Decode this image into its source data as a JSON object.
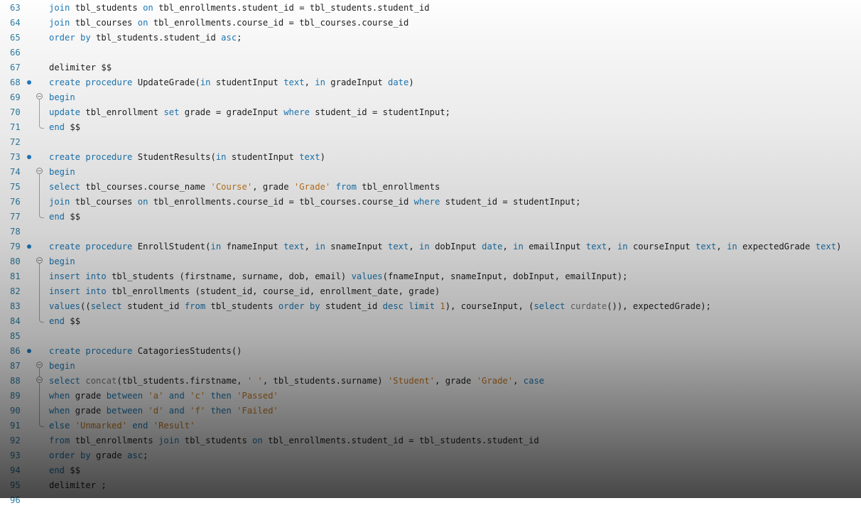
{
  "editor": {
    "language": "sql",
    "colors": {
      "keyword": "#1c7ab8",
      "string": "#c87a20",
      "function": "#7d7d7d",
      "identifier": "#1e1e1e",
      "line_number": "#2f7fa3",
      "breakpoint": "#1e7ec8"
    },
    "lines": [
      {
        "n": "63",
        "bp": false,
        "fold": "",
        "tokens": [
          [
            "kw",
            "join"
          ],
          [
            "",
            "tbl_students "
          ],
          [
            "kw",
            "on"
          ],
          [
            "",
            "tbl_enrollments.student_id = tbl_students.student_id"
          ]
        ]
      },
      {
        "n": "64",
        "bp": false,
        "fold": "",
        "tokens": [
          [
            "kw",
            "join"
          ],
          [
            "",
            "tbl_courses "
          ],
          [
            "kw",
            "on"
          ],
          [
            "",
            "tbl_enrollments.course_id = tbl_courses.course_id"
          ]
        ]
      },
      {
        "n": "65",
        "bp": false,
        "fold": "",
        "tokens": [
          [
            "kw",
            "order by"
          ],
          [
            "",
            "tbl_students.student_id "
          ],
          [
            "kw",
            "asc"
          ],
          [
            "",
            ";"
          ]
        ]
      },
      {
        "n": "66",
        "bp": false,
        "fold": "",
        "tokens": []
      },
      {
        "n": "67",
        "bp": false,
        "fold": "",
        "tokens": [
          [
            "",
            "delimiter $$"
          ]
        ]
      },
      {
        "n": "68",
        "bp": true,
        "fold": "",
        "tokens": [
          [
            "kw",
            "create procedure"
          ],
          [
            "",
            "UpdateGrade("
          ],
          [
            "kw",
            "in"
          ],
          [
            "",
            "studentInput "
          ],
          [
            "kw",
            "text"
          ],
          [
            "",
            ", "
          ],
          [
            "kw",
            "in"
          ],
          [
            "",
            "gradeInput "
          ],
          [
            "kw",
            "date"
          ],
          [
            "",
            ")"
          ]
        ]
      },
      {
        "n": "69",
        "bp": false,
        "fold": "start",
        "tokens": [
          [
            "kw",
            "begin"
          ]
        ]
      },
      {
        "n": "70",
        "bp": false,
        "fold": "mid",
        "tokens": [
          [
            "kw",
            "update"
          ],
          [
            "",
            "tbl_enrollment "
          ],
          [
            "kw",
            "set"
          ],
          [
            "",
            "grade = gradeInput "
          ],
          [
            "kw",
            "where"
          ],
          [
            "",
            "student_id = studentInput;"
          ]
        ]
      },
      {
        "n": "71",
        "bp": false,
        "fold": "end",
        "tokens": [
          [
            "kw",
            "end"
          ],
          [
            "",
            "$$"
          ]
        ]
      },
      {
        "n": "72",
        "bp": false,
        "fold": "",
        "tokens": []
      },
      {
        "n": "73",
        "bp": true,
        "fold": "",
        "tokens": [
          [
            "kw",
            "create procedure"
          ],
          [
            "",
            "StudentResults("
          ],
          [
            "kw",
            "in"
          ],
          [
            "",
            "studentInput "
          ],
          [
            "kw",
            "text"
          ],
          [
            "",
            ")"
          ]
        ]
      },
      {
        "n": "74",
        "bp": false,
        "fold": "start",
        "tokens": [
          [
            "kw",
            "begin"
          ]
        ]
      },
      {
        "n": "75",
        "bp": false,
        "fold": "mid",
        "tokens": [
          [
            "kw",
            "select"
          ],
          [
            "",
            "tbl_courses.course_name "
          ],
          [
            "str",
            "'Course'"
          ],
          [
            "",
            ", grade "
          ],
          [
            "str",
            "'Grade'"
          ],
          [
            "",
            ""
          ],
          [
            "kw",
            " from"
          ],
          [
            "",
            "tbl_enrollments"
          ]
        ]
      },
      {
        "n": "76",
        "bp": false,
        "fold": "mid",
        "tokens": [
          [
            "kw",
            "join"
          ],
          [
            "",
            "tbl_courses "
          ],
          [
            "kw",
            "on"
          ],
          [
            "",
            "tbl_enrollments.course_id = tbl_courses.course_id "
          ],
          [
            "kw",
            "where"
          ],
          [
            "",
            "student_id = studentInput;"
          ]
        ]
      },
      {
        "n": "77",
        "bp": false,
        "fold": "end",
        "tokens": [
          [
            "kw",
            "end"
          ],
          [
            "",
            "$$"
          ]
        ]
      },
      {
        "n": "78",
        "bp": false,
        "fold": "",
        "tokens": []
      },
      {
        "n": "79",
        "bp": true,
        "fold": "",
        "tokens": [
          [
            "kw",
            "create procedure"
          ],
          [
            "",
            "EnrollStudent("
          ],
          [
            "kw",
            "in"
          ],
          [
            "",
            "fnameInput "
          ],
          [
            "kw",
            "text"
          ],
          [
            "",
            ", "
          ],
          [
            "kw",
            "in"
          ],
          [
            "",
            "snameInput "
          ],
          [
            "kw",
            "text"
          ],
          [
            "",
            ", "
          ],
          [
            "kw",
            "in"
          ],
          [
            "",
            "dobInput "
          ],
          [
            "kw",
            "date"
          ],
          [
            "",
            ", "
          ],
          [
            "kw",
            "in"
          ],
          [
            "",
            "emailInput "
          ],
          [
            "kw",
            "text"
          ],
          [
            "",
            ", "
          ],
          [
            "kw",
            "in"
          ],
          [
            "",
            "courseInput "
          ],
          [
            "kw",
            "text"
          ],
          [
            "",
            ", "
          ],
          [
            "kw",
            "in"
          ],
          [
            "",
            "expectedGrade "
          ],
          [
            "kw",
            "text"
          ],
          [
            "",
            ")"
          ]
        ]
      },
      {
        "n": "80",
        "bp": false,
        "fold": "start",
        "tokens": [
          [
            "kw",
            "begin"
          ]
        ]
      },
      {
        "n": "81",
        "bp": false,
        "fold": "mid",
        "tokens": [
          [
            "kw",
            "insert into"
          ],
          [
            "",
            "tbl_students (firstname, surname, dob, email) "
          ],
          [
            "kw",
            "values"
          ],
          [
            "",
            "(fnameInput, snameInput, dobInput, emailInput);"
          ]
        ]
      },
      {
        "n": "82",
        "bp": false,
        "fold": "mid",
        "tokens": [
          [
            "kw",
            "insert into"
          ],
          [
            "",
            "tbl_enrollments (student_id, course_id, enrollment_date, grade)"
          ]
        ]
      },
      {
        "n": "83",
        "bp": false,
        "fold": "mid",
        "tokens": [
          [
            "kw",
            "values"
          ],
          [
            "",
            "(("
          ],
          [
            "kw",
            "select"
          ],
          [
            "",
            "student_id "
          ],
          [
            "kw",
            "from"
          ],
          [
            "",
            "tbl_students "
          ],
          [
            "kw",
            "order by"
          ],
          [
            "",
            "student_id "
          ],
          [
            "kw",
            "desc limit"
          ],
          [
            "num",
            "1"
          ],
          [
            "",
            "), courseInput, ("
          ],
          [
            "kw",
            "select"
          ],
          [
            "fn",
            "curdate"
          ],
          [
            "",
            "()), expectedGrade);"
          ]
        ]
      },
      {
        "n": "84",
        "bp": false,
        "fold": "end",
        "tokens": [
          [
            "kw",
            "end"
          ],
          [
            "",
            "$$"
          ]
        ]
      },
      {
        "n": "85",
        "bp": false,
        "fold": "",
        "tokens": []
      },
      {
        "n": "86",
        "bp": true,
        "fold": "",
        "tokens": [
          [
            "kw",
            "create procedure"
          ],
          [
            "",
            "CatagoriesStudents()"
          ]
        ]
      },
      {
        "n": "87",
        "bp": false,
        "fold": "start",
        "tokens": [
          [
            "kw",
            "begin"
          ]
        ]
      },
      {
        "n": "88",
        "bp": false,
        "fold": "start2",
        "tokens": [
          [
            "kw",
            "select"
          ],
          [
            "fn",
            "concat"
          ],
          [
            "",
            "(tbl_students.firstname, "
          ],
          [
            "str",
            "' '"
          ],
          [
            "",
            ", tbl_students.surname) "
          ],
          [
            "str",
            "'Student'"
          ],
          [
            "",
            ", grade "
          ],
          [
            "str",
            "'Grade'"
          ],
          [
            "",
            ", "
          ],
          [
            "kw",
            "case"
          ]
        ]
      },
      {
        "n": "89",
        "bp": false,
        "fold": "mid",
        "tokens": [
          [
            "kw",
            "when"
          ],
          [
            "",
            "grade "
          ],
          [
            "kw",
            "between"
          ],
          [
            "str",
            "'a'"
          ],
          [
            "kw",
            " and"
          ],
          [
            "str",
            "'c'"
          ],
          [
            "kw",
            " then"
          ],
          [
            "str",
            "'Passed'"
          ]
        ]
      },
      {
        "n": "90",
        "bp": false,
        "fold": "mid",
        "tokens": [
          [
            "kw",
            "when"
          ],
          [
            "",
            "grade "
          ],
          [
            "kw",
            "between"
          ],
          [
            "str",
            "'d'"
          ],
          [
            "kw",
            " and"
          ],
          [
            "str",
            "'f'"
          ],
          [
            "kw",
            " then"
          ],
          [
            "str",
            "'Failed'"
          ]
        ]
      },
      {
        "n": "91",
        "bp": false,
        "fold": "end",
        "tokens": [
          [
            "kw",
            "else"
          ],
          [
            "str",
            "'Unmarked'"
          ],
          [
            "kw",
            " end"
          ],
          [
            "str",
            "'Result'"
          ]
        ]
      },
      {
        "n": "92",
        "bp": false,
        "fold": "",
        "tokens": [
          [
            "kw",
            "from"
          ],
          [
            "",
            "tbl_enrollments "
          ],
          [
            "kw",
            "join"
          ],
          [
            "",
            "tbl_students "
          ],
          [
            "kw",
            "on"
          ],
          [
            "",
            "tbl_enrollments.student_id = tbl_students.student_id"
          ]
        ]
      },
      {
        "n": "93",
        "bp": false,
        "fold": "",
        "tokens": [
          [
            "kw",
            "order by"
          ],
          [
            "",
            "grade "
          ],
          [
            "kw",
            "asc"
          ],
          [
            "",
            ";"
          ]
        ]
      },
      {
        "n": "94",
        "bp": false,
        "fold": "",
        "tokens": [
          [
            "kw",
            "end"
          ],
          [
            "",
            "$$"
          ]
        ]
      },
      {
        "n": "95",
        "bp": false,
        "fold": "",
        "tokens": [
          [
            "",
            "delimiter ;"
          ]
        ]
      },
      {
        "n": "96",
        "bp": false,
        "fold": "",
        "tokens": []
      }
    ]
  }
}
